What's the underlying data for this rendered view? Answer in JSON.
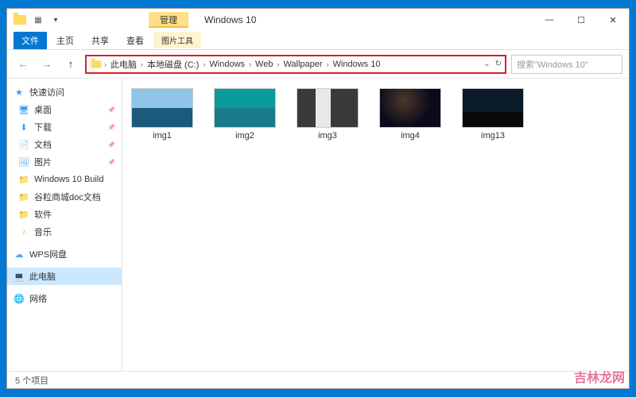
{
  "titlebar": {
    "title": "Windows 10",
    "manage_tab": "管理",
    "controls": {
      "min": "—",
      "max": "☐",
      "close": "✕"
    }
  },
  "ribbon": {
    "file": "文件",
    "home": "主页",
    "share": "共享",
    "view": "查看",
    "tool": "图片工具"
  },
  "nav": {
    "back": "←",
    "forward": "→",
    "up": "↑",
    "dropdown": "⌄",
    "refresh": "↻"
  },
  "breadcrumb": {
    "items": [
      "此电脑",
      "本地磁盘 (C:)",
      "Windows",
      "Web",
      "Wallpaper",
      "Windows 10"
    ]
  },
  "search": {
    "placeholder": "搜索\"Windows 10\""
  },
  "sidebar": {
    "quick": "快速访问",
    "desktop": "桌面",
    "downloads": "下载",
    "documents": "文档",
    "pictures": "图片",
    "win10build": "Windows 10 Build",
    "guli": "谷粒商城doc文档",
    "software": "软件",
    "music": "音乐",
    "wps": "WPS网盘",
    "thispc": "此电脑",
    "network": "网络"
  },
  "thumbnails": [
    {
      "name": "img1"
    },
    {
      "name": "img2"
    },
    {
      "name": "img3"
    },
    {
      "name": "img4"
    },
    {
      "name": "img13"
    }
  ],
  "statusbar": {
    "text": "5 个项目"
  },
  "watermark": "吉林龙网"
}
